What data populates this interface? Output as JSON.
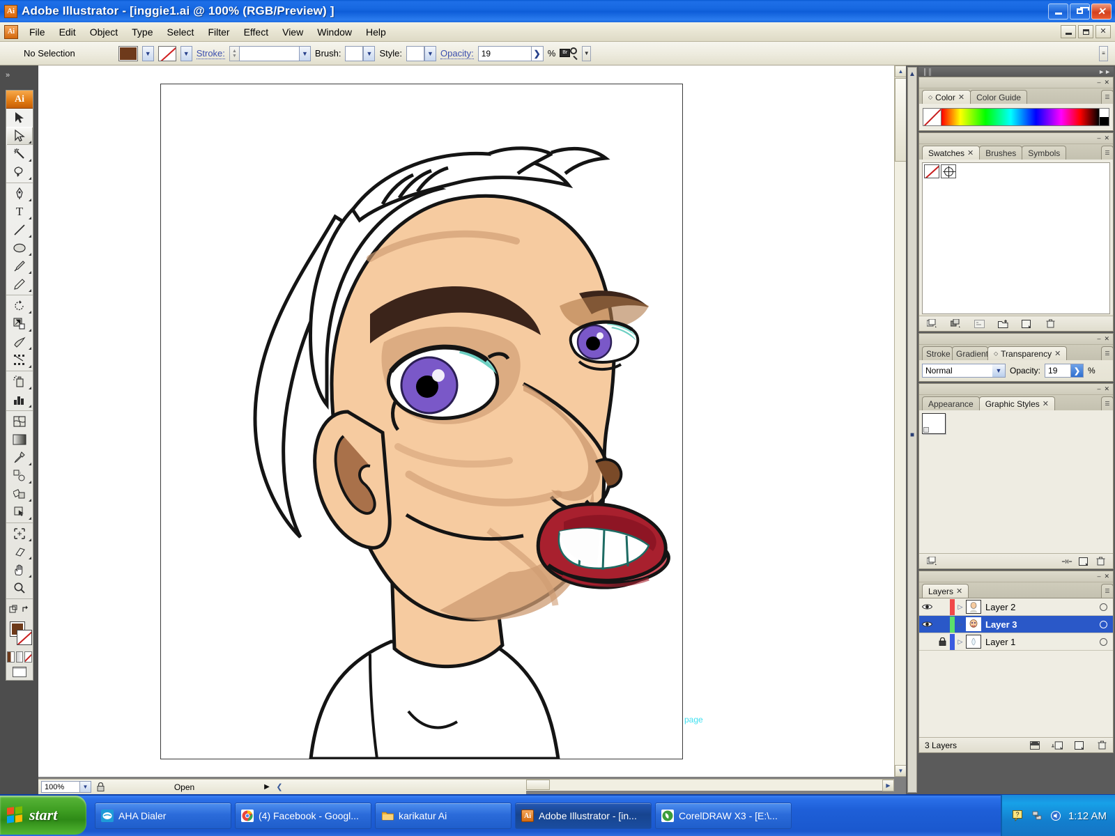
{
  "window": {
    "title": "Adobe Illustrator - [inggie1.ai @ 100% (RGB/Preview) ]",
    "app_icon": "Ai",
    "minimize_label": "Minimize",
    "restore_label": "Restore",
    "close_label": "Close"
  },
  "menubar": {
    "app_icon": "Ai",
    "items": [
      {
        "label": "File"
      },
      {
        "label": "Edit"
      },
      {
        "label": "Object"
      },
      {
        "label": "Type"
      },
      {
        "label": "Select"
      },
      {
        "label": "Filter"
      },
      {
        "label": "Effect"
      },
      {
        "label": "View"
      },
      {
        "label": "Window"
      },
      {
        "label": "Help"
      }
    ],
    "doc_minimize": "–",
    "doc_restore": "❐",
    "doc_close": "×"
  },
  "controlbar": {
    "selection_status": "No Selection",
    "fill_color": "#6E3A1B",
    "stroke_label": "Stroke:",
    "stroke_value": "",
    "brush_label": "Brush:",
    "brush_value": "",
    "style_label": "Style:",
    "style_value": "",
    "opacity_label": "Opacity:",
    "opacity_value": "19",
    "opacity_unit": "%",
    "bridge_icon": "Br"
  },
  "toolbox": {
    "header": "Ai",
    "tools": [
      {
        "name": "selection-tool",
        "glyph": "▶"
      },
      {
        "name": "direct-selection-tool",
        "glyph": "▷",
        "selected": true
      },
      {
        "name": "magic-wand-tool",
        "glyph": "✳"
      },
      {
        "name": "lasso-tool",
        "glyph": "℘"
      },
      {
        "name": "pen-tool",
        "glyph": "✒"
      },
      {
        "name": "type-tool",
        "glyph": "T"
      },
      {
        "name": "line-segment-tool",
        "glyph": "╲"
      },
      {
        "name": "ellipse-tool",
        "glyph": "⬭"
      },
      {
        "name": "paintbrush-tool",
        "glyph": "✎"
      },
      {
        "name": "pencil-tool",
        "glyph": "✏"
      },
      {
        "name": "rotate-tool",
        "glyph": "↻"
      },
      {
        "name": "scale-tool",
        "glyph": "⤡"
      },
      {
        "name": "warp-tool",
        "glyph": "≋"
      },
      {
        "name": "free-transform-tool",
        "glyph": "⛶"
      },
      {
        "name": "symbol-sprayer-tool",
        "glyph": "⚗"
      },
      {
        "name": "column-graph-tool",
        "glyph": "ὌA"
      },
      {
        "name": "mesh-tool",
        "glyph": "⊞"
      },
      {
        "name": "gradient-tool",
        "glyph": "▧"
      },
      {
        "name": "eyedropper-tool",
        "glyph": "⚒"
      },
      {
        "name": "blend-tool",
        "glyph": "⬡"
      },
      {
        "name": "live-paint-bucket-tool",
        "glyph": "◇"
      },
      {
        "name": "live-paint-selection-tool",
        "glyph": "▣"
      },
      {
        "name": "crop-area-tool",
        "glyph": "⌑"
      },
      {
        "name": "slice-tool",
        "glyph": "✂"
      },
      {
        "name": "hand-tool",
        "glyph": "✋"
      },
      {
        "name": "zoom-tool",
        "glyph": "⚲"
      }
    ],
    "fill_color": "#6E3A1B",
    "stroke_color": "#FFFFFF"
  },
  "canvas": {
    "page_label": "page",
    "artboard_background": "#FFFFFF"
  },
  "statusbar": {
    "zoom_value": "100%",
    "lock_icon": "🔒",
    "status_text": "Open",
    "next_arrow": "▶",
    "prev_arrow": "❮"
  },
  "panels": {
    "color": {
      "tabs": [
        {
          "label": "Color",
          "active": true,
          "closable": true
        },
        {
          "label": "Color Guide",
          "active": false,
          "closable": false
        }
      ]
    },
    "swatches": {
      "tabs": [
        {
          "label": "Swatches",
          "active": true,
          "closable": true
        },
        {
          "label": "Brushes",
          "active": false,
          "closable": false
        },
        {
          "label": "Symbols",
          "active": false,
          "closable": false
        }
      ],
      "footer_icons": [
        "swatch-libraries-icon",
        "show-swatch-kinds-icon",
        "swatch-options-icon",
        "new-color-group-icon",
        "new-swatch-icon",
        "delete-swatch-icon"
      ]
    },
    "transparency": {
      "tabs": [
        {
          "label": "Stroke",
          "active": false,
          "closable": false
        },
        {
          "label": "Gradient",
          "active": false,
          "closable": false
        },
        {
          "label": "Transparency",
          "active": true,
          "closable": true
        }
      ],
      "blend_mode": "Normal",
      "opacity_label": "Opacity:",
      "opacity_value": "19",
      "opacity_unit": "%"
    },
    "graphic_styles": {
      "tabs": [
        {
          "label": "Appearance",
          "active": false,
          "closable": false
        },
        {
          "label": "Graphic Styles",
          "active": true,
          "closable": true
        }
      ],
      "footer_icons": [
        "graphic-styles-libraries-icon",
        "break-link-icon",
        "new-graphic-style-icon",
        "delete-graphic-style-icon"
      ]
    },
    "layers": {
      "tabs": [
        {
          "label": "Layers",
          "active": true,
          "closable": true
        }
      ],
      "rows": [
        {
          "name": "Layer 2",
          "visible": true,
          "locked": false,
          "selected": false,
          "color": "#F0484A"
        },
        {
          "name": "Layer 3",
          "visible": true,
          "locked": false,
          "selected": true,
          "color": "#5CE06A"
        },
        {
          "name": "Layer 1",
          "visible": false,
          "locked": true,
          "selected": false,
          "color": "#3A5BE0"
        }
      ],
      "count_label": "3 Layers",
      "footer_icons": [
        "make-clipping-mask-icon",
        "create-new-sublayer-icon",
        "create-new-layer-icon",
        "delete-selection-icon"
      ]
    }
  },
  "taskbar": {
    "start_label": "start",
    "items": [
      {
        "label": "AHA Dialer",
        "icon": "aha-dialer-icon",
        "icon_color": "#1E9BD8",
        "active": false
      },
      {
        "label": "(4) Facebook - Googl...",
        "icon": "chrome-icon",
        "icon_color": "#E8E8E8",
        "active": false
      },
      {
        "label": "karikatur Ai",
        "icon": "folder-icon",
        "icon_color": "#F0B233",
        "active": false
      },
      {
        "label": "Adobe Illustrator - [in...",
        "icon": "illustrator-icon",
        "icon_color": "#E06A0E",
        "active": true
      },
      {
        "label": "CorelDRAW X3 - [E:\\...",
        "icon": "coreldraw-icon",
        "icon_color": "#3C9E3C",
        "active": false
      }
    ],
    "tray_icons": [
      "help-balloon-icon",
      "network-icon",
      "volume-icon"
    ],
    "clock": "1:12 AM"
  }
}
